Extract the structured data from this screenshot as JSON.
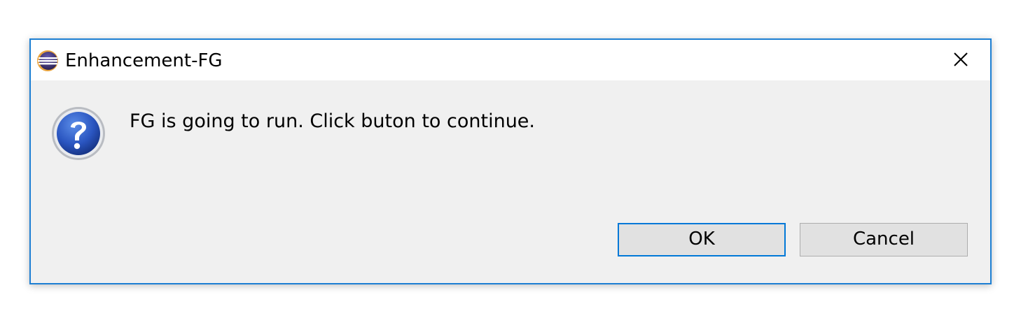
{
  "window": {
    "title": "Enhancement-FG",
    "app_icon": "eclipse-icon",
    "close_icon": "close-icon"
  },
  "dialog": {
    "icon": "question-icon",
    "message": "FG is going to run. Click buton to continue."
  },
  "buttons": {
    "ok_label": "OK",
    "cancel_label": "Cancel"
  },
  "colors": {
    "border_accent": "#1d7fd3",
    "body_bg": "#f0f0f0",
    "titlebar_bg": "#ffffff",
    "default_button_border": "#0078d7",
    "button_bg": "#e1e1e1",
    "question_icon_blue": "#1f4fb5"
  }
}
